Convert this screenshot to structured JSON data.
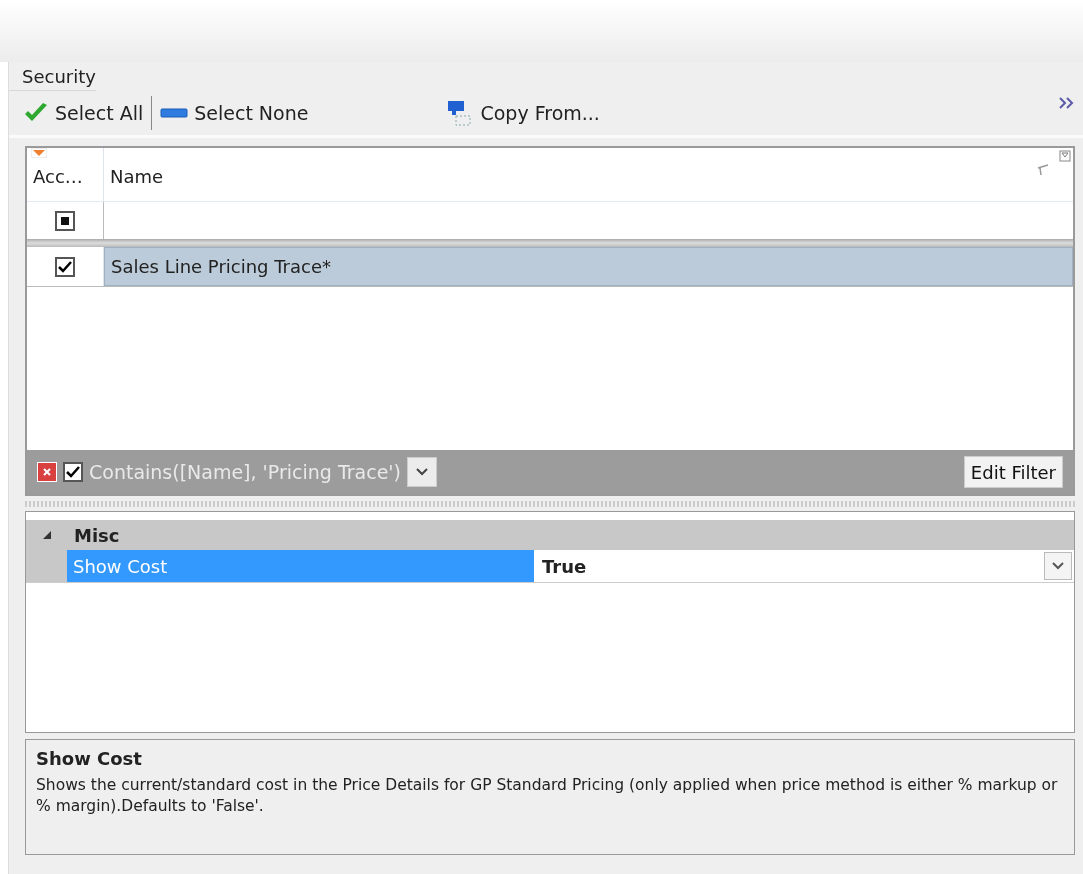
{
  "group": {
    "title": "Security"
  },
  "toolbar": [
    {
      "kind": "check",
      "label": "Select All"
    },
    {
      "kind": "bar",
      "label": "Select None"
    },
    {
      "kind": "copy",
      "label": "Copy From..."
    }
  ],
  "grid": {
    "columns": [
      "Acc…",
      "Name"
    ],
    "filter_row": {
      "indeterminate": true
    },
    "rows": [
      {
        "checked": true,
        "name": "Sales Line Pricing Trace*",
        "selected": true
      }
    ],
    "filter_bar": {
      "enabled": true,
      "expression": "Contains([Name], 'Pricing Trace')",
      "button": "Edit Filter"
    }
  },
  "properties": {
    "category": {
      "name": "Misc",
      "expanded": true
    },
    "items": [
      {
        "name": "Show Cost",
        "value": "True",
        "selected": true
      }
    ]
  },
  "description": {
    "title": "Show Cost",
    "text": "Shows the current/standard cost in the Price Details for GP Standard Pricing (only applied when price method is either % markup or % margin).Defaults to 'False'."
  }
}
